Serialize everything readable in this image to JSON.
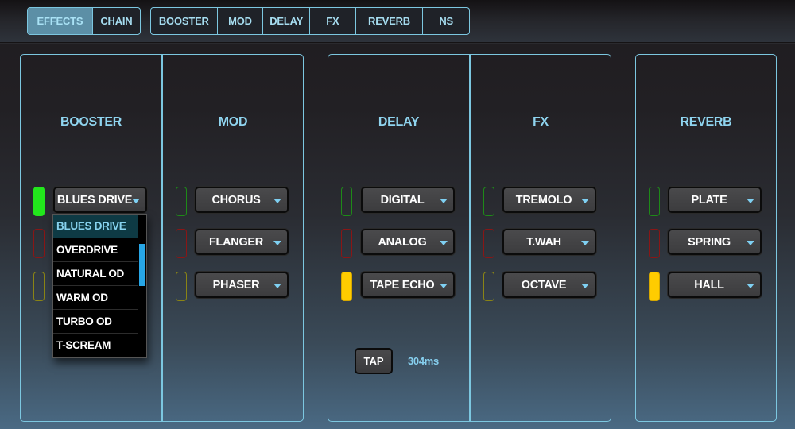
{
  "view_tabs": [
    {
      "label": "EFFECTS",
      "active": true
    },
    {
      "label": "CHAIN",
      "active": false
    }
  ],
  "effect_tabs": [
    {
      "label": "BOOSTER"
    },
    {
      "label": "MOD"
    },
    {
      "label": "DELAY"
    },
    {
      "label": "FX"
    },
    {
      "label": "REVERB"
    },
    {
      "label": "NS"
    }
  ],
  "sections": {
    "booster": {
      "title": "BOOSTER",
      "slots": [
        {
          "value": "BLUES DRIVE",
          "led": "green",
          "on": true
        },
        {
          "value": "",
          "led": "red",
          "on": false
        },
        {
          "value": "",
          "led": "yellow",
          "on": false
        }
      ],
      "menu": {
        "open": true,
        "options": [
          "BLUES DRIVE",
          "OVERDRIVE",
          "NATURAL OD",
          "WARM OD",
          "TURBO OD",
          "T-SCREAM"
        ],
        "selected": "BLUES DRIVE"
      }
    },
    "mod": {
      "title": "MOD",
      "slots": [
        {
          "value": "CHORUS",
          "led": "green",
          "on": false
        },
        {
          "value": "FLANGER",
          "led": "red",
          "on": false
        },
        {
          "value": "PHASER",
          "led": "yellow",
          "on": false
        }
      ]
    },
    "delay": {
      "title": "DELAY",
      "slots": [
        {
          "value": "DIGITAL",
          "led": "green",
          "on": false
        },
        {
          "value": "ANALOG",
          "led": "red",
          "on": false
        },
        {
          "value": "TAPE ECHO",
          "led": "yellow",
          "on": true
        }
      ],
      "tap_label": "TAP",
      "tap_value": "304ms"
    },
    "fx": {
      "title": "FX",
      "slots": [
        {
          "value": "TREMOLO",
          "led": "green",
          "on": false
        },
        {
          "value": "T.WAH",
          "led": "red",
          "on": false
        },
        {
          "value": "OCTAVE",
          "led": "yellow",
          "on": false
        }
      ]
    },
    "reverb": {
      "title": "REVERB",
      "slots": [
        {
          "value": "PLATE",
          "led": "green",
          "on": false
        },
        {
          "value": "SPRING",
          "led": "red",
          "on": false
        },
        {
          "value": "HALL",
          "led": "yellow",
          "on": true
        }
      ]
    }
  },
  "colors": {
    "accent": "#7cc7e0",
    "led_green": "#22e61c",
    "led_yellow": "#ffcc00",
    "led_red": "#8a1616",
    "scroll_thumb": "#27a6e6"
  }
}
